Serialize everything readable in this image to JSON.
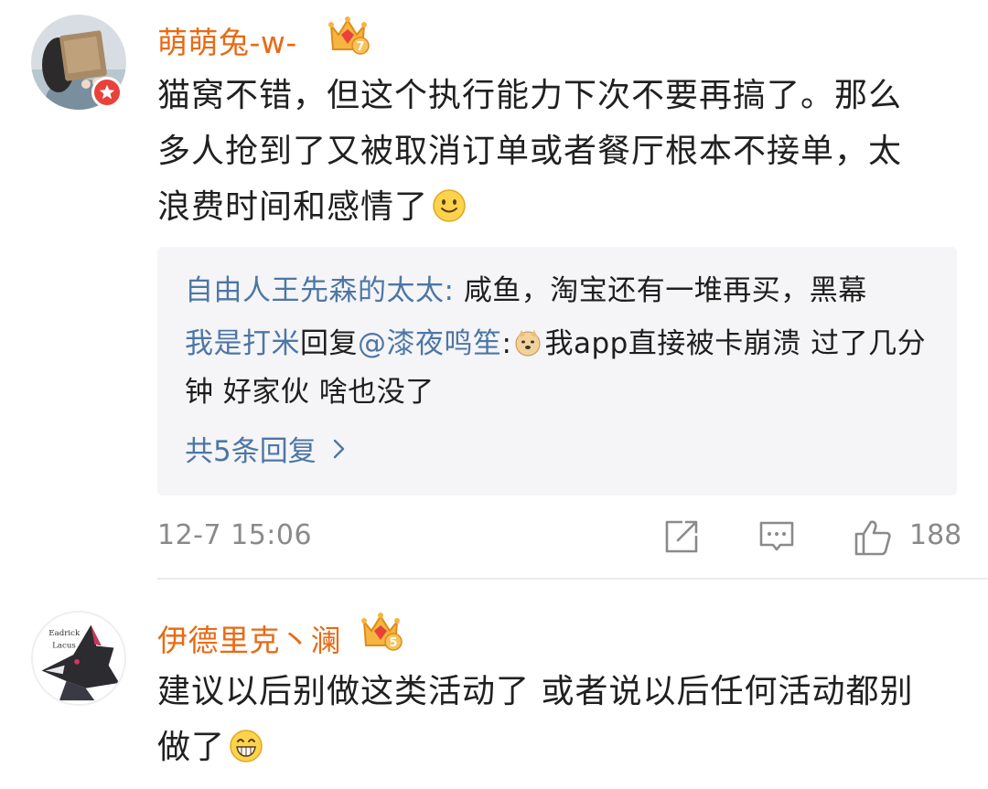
{
  "comments": [
    {
      "username": "萌萌兔-w-",
      "text": "猫窝不错，但这个执行能力下次不要再搞了。那么多人抢到了又被取消订单或者餐厅根本不接单，太浪费时间和感情了",
      "avatar_icon": "user-avatar-photo",
      "badge_icon": "verified-badge-icon",
      "level_icon": "vip-crown-icon",
      "level_number": "7",
      "end_emoji": "smile-emoji",
      "replies": [
        {
          "author": "自由人王先森的太太",
          "separator": ": ",
          "text": "咸鱼，淘宝还有一堆再买，黑幕"
        },
        {
          "author": "我是打米",
          "reply_word": "回复",
          "mention": "@漆夜鸣笙",
          "separator": ":",
          "emoji": "doge-emoji",
          "text": "我app直接被卡崩溃 过了几分钟 好家伙 啥也没了"
        }
      ],
      "more_replies_label": "共5条回复",
      "timestamp": "12-7 15:06",
      "like_count": "188"
    },
    {
      "username": "伊德里克丶澜",
      "text": "建议以后别做这类活动了 或者说以后任何活动都别做了",
      "avatar_icon": "wolf-avatar-drawing",
      "avatar_caption_1": "Eadrick",
      "avatar_caption_2": "Lacus",
      "level_icon": "vip-crown-icon",
      "level_number": "5",
      "end_emoji": "grin-emoji"
    }
  ],
  "colors": {
    "username": "#e96a14",
    "reply_name": "#4d76a6",
    "meta_gray": "#8a8a8a",
    "reply_bg": "#f5f5f7",
    "badge_red": "#e9423a"
  }
}
